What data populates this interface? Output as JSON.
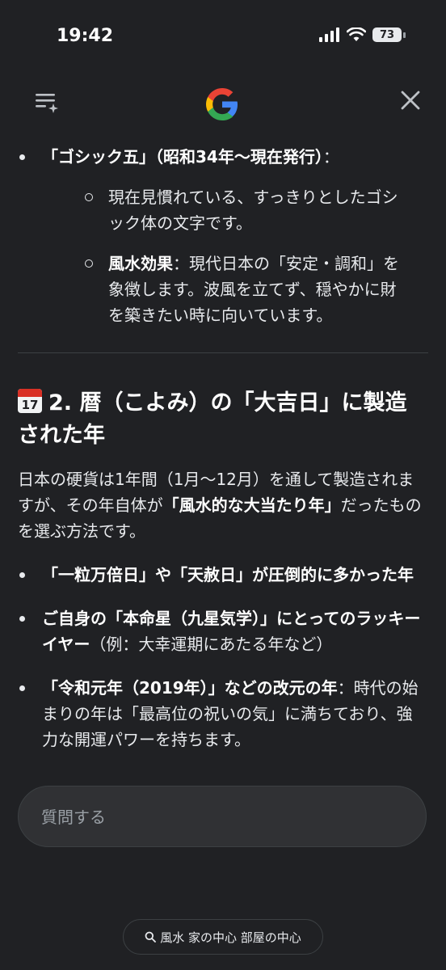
{
  "status_bar": {
    "time": "19:42",
    "battery": "73"
  },
  "icons": {
    "menu": "menu-sparkle-icon",
    "logo": "google-logo",
    "close": "close-icon",
    "calendar": "calendar-icon",
    "search": "search-icon"
  },
  "section1": {
    "bullet_title": "「ゴシック五」（昭和34年〜現在発行）",
    "bullet_colon": "：",
    "sub1": "現在見慣れている、すっきりとしたゴシック体の文字です。",
    "sub2_bold": "風水効果",
    "sub2_text": "：現代日本の「安定・調和」を象徴します。波風を立てず、穏やかに財を築きたい時に向いています。"
  },
  "section2": {
    "calendar_day": "17",
    "heading": "2. 暦（こよみ）の「大吉日」に製造された年",
    "para_a": "日本の硬貨は1年間（1月〜12月）を通して製造されますが、その年自体が",
    "para_bold": "「風水的な大当たり年」",
    "para_b": "だったものを選ぶ方法です。",
    "bullets": [
      {
        "bold": "「一粒万倍日」や「天赦日」が圧倒的に多かった年",
        "text": ""
      },
      {
        "bold": "ご自身の「本命星（九星気学）」にとってのラッキーイヤー",
        "text": "（例：大幸運期にあたる年など）"
      },
      {
        "bold": "「令和元年（2019年）」などの改元の年",
        "text": "：時代の始まりの年は「最高位の祝いの気」に満ちており、強力な開運パワーを持ちます。"
      }
    ]
  },
  "input": {
    "placeholder": "質問する"
  },
  "chip": {
    "label": "風水 家の中心 部屋の中心"
  }
}
